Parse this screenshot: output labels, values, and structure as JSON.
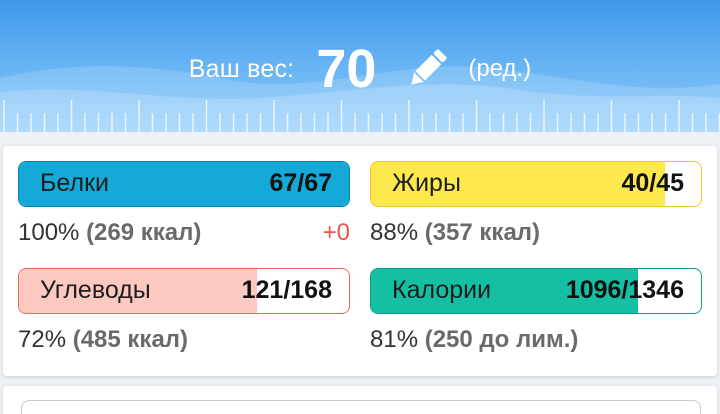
{
  "header": {
    "weight_label": "Ваш вес:",
    "weight_value": "70",
    "edit_label": "(ред.)",
    "icon": "pencil-icon"
  },
  "macros": [
    {
      "id": "protein",
      "name": "Белки",
      "value": "67/67",
      "percent_text": "100%",
      "kcal_text": "(269 ккал)",
      "delta": "+0",
      "fill_fraction": 1.0,
      "fill_color": "#14a9d6",
      "border_color": "#0c7fb0"
    },
    {
      "id": "fat",
      "name": "Жиры",
      "value": "40/45",
      "percent_text": "88%",
      "kcal_text": "(357 ккал)",
      "fill_fraction": 0.89,
      "fill_color": "#fde94d",
      "border_color": "#e5c62a"
    },
    {
      "id": "carbs",
      "name": "Углеводы",
      "value": "121/168",
      "percent_text": "72%",
      "kcal_text": "(485 ккал)",
      "fill_fraction": 0.72,
      "fill_color": "#fcc9c1",
      "border_color": "#ea6a5e"
    },
    {
      "id": "calories",
      "name": "Калории",
      "value": "1096/1346",
      "percent_text": "81%",
      "kcal_text": "(250 до лим.)",
      "fill_fraction": 0.81,
      "fill_color": "#14bfa3",
      "border_color": "#0d9b86"
    }
  ]
}
